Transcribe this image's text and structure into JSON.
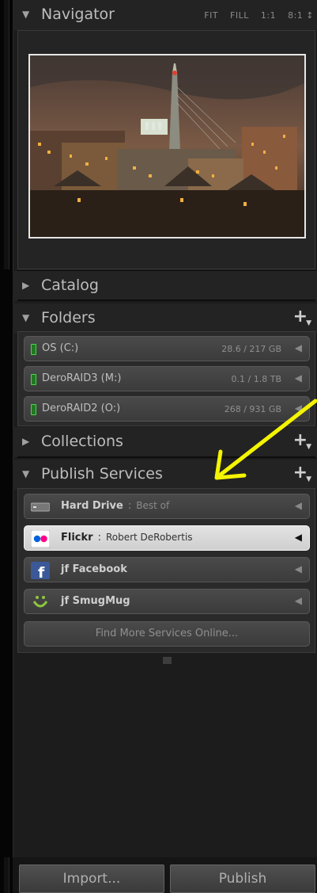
{
  "navigator": {
    "title": "Navigator",
    "options": [
      "FIT",
      "FILL",
      "1:1",
      "8:1 ↕"
    ]
  },
  "catalog": {
    "title": "Catalog"
  },
  "folders": {
    "title": "Folders",
    "add": "+",
    "items": [
      {
        "name": "OS (C:)",
        "size": "28.6 / 217 GB"
      },
      {
        "name": "DeroRAID3 (M:)",
        "size": "0.1 / 1.8 TB"
      },
      {
        "name": "DeroRAID2 (O:)",
        "size": "268 / 931 GB"
      }
    ]
  },
  "collections": {
    "title": "Collections",
    "add": "+"
  },
  "publish": {
    "title": "Publish Services",
    "add": "+",
    "services": [
      {
        "name": "Hard Drive",
        "sub": "Best of",
        "icon": "hard-drive-icon",
        "selected": false
      },
      {
        "name": "Flickr",
        "sub": "Robert DeRobertis",
        "icon": "flickr-icon",
        "selected": true
      },
      {
        "name": "jf Facebook",
        "sub": "",
        "icon": "facebook-icon",
        "selected": false
      },
      {
        "name": "jf SmugMug",
        "sub": "",
        "icon": "smugmug-icon",
        "selected": false
      }
    ],
    "find_more": "Find More Services Online..."
  },
  "buttons": {
    "import": "Import...",
    "publish": "Publish"
  },
  "colors": {
    "annotation_arrow": "#f4f400",
    "selected_row": "#d9d9d9",
    "folder_led": "#4bd64b"
  }
}
